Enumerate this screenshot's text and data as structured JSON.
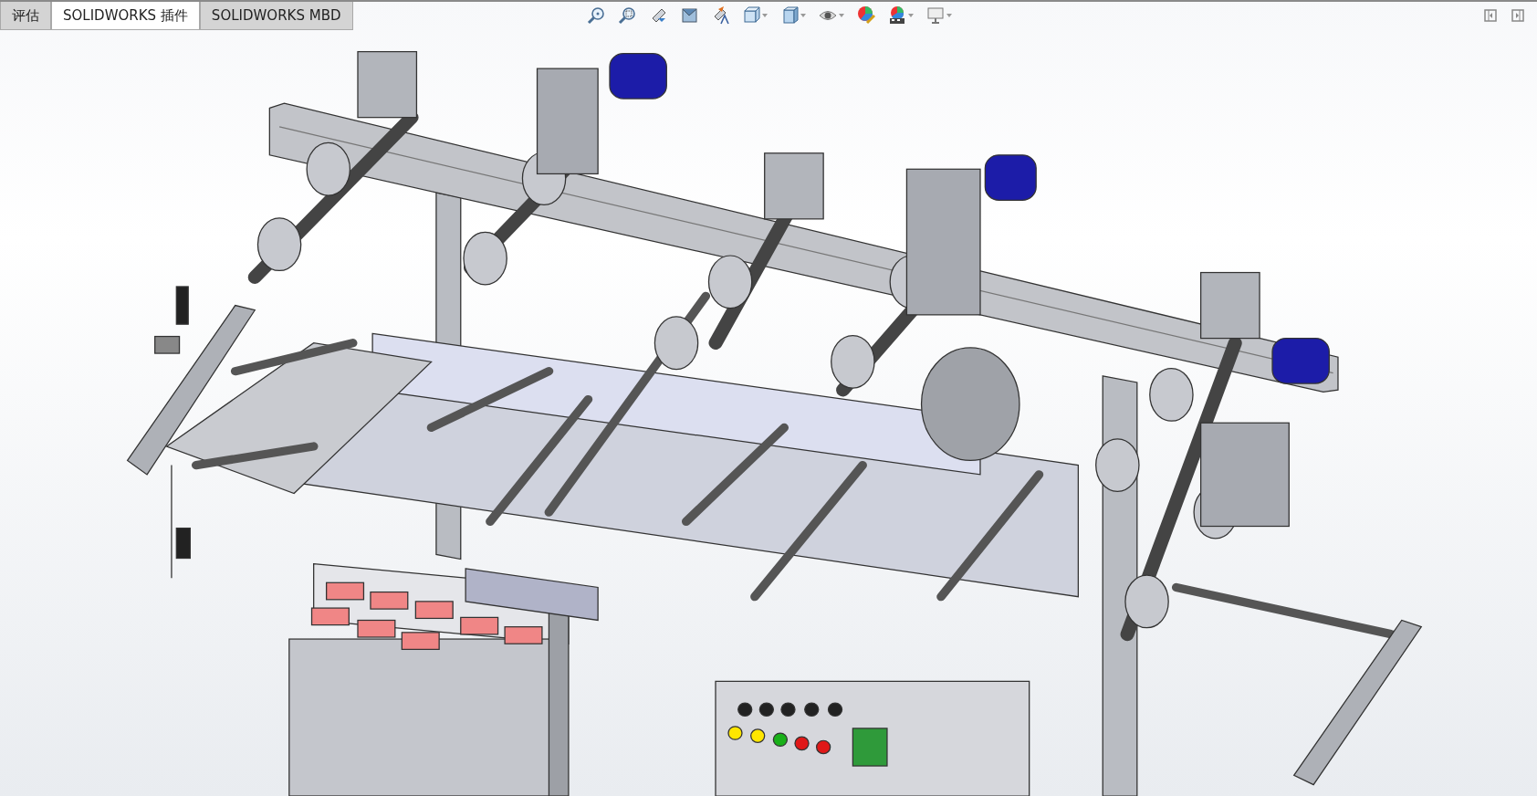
{
  "tabs": [
    {
      "label": "评估",
      "selected": false
    },
    {
      "label": "SOLIDWORKS 插件",
      "selected": true
    },
    {
      "label": "SOLIDWORKS MBD",
      "selected": false
    }
  ],
  "view_toolbar": [
    {
      "dropdown": false
    },
    {
      "dropdown": false
    },
    {
      "dropdown": false
    },
    {
      "dropdown": false
    },
    {
      "dropdown": false
    },
    {
      "dropdown": true
    },
    {
      "dropdown": true
    },
    {
      "dropdown": true
    },
    {
      "dropdown": false
    },
    {
      "dropdown": true
    },
    {
      "dropdown": true
    }
  ]
}
